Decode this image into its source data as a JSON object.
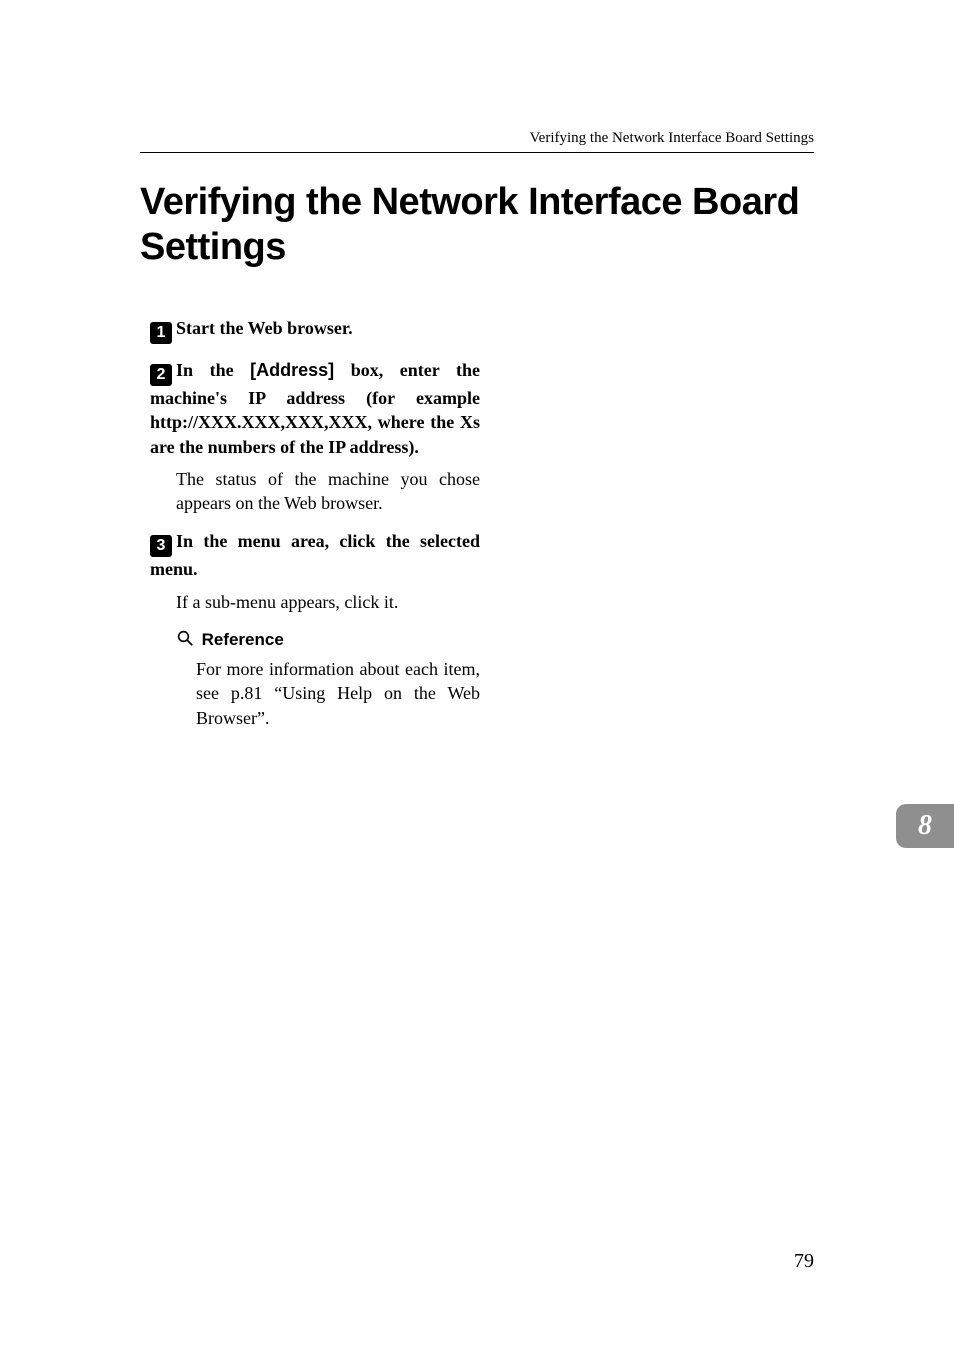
{
  "running_head": "Verifying the Network Interface Board Settings",
  "title": "Verifying the Network Interface Board Settings",
  "steps": [
    {
      "num": "1",
      "head_html": "Start the Web browser."
    },
    {
      "num": "2",
      "head_prefix": "In the ",
      "head_ui": "[Address]",
      "head_suffix": " box, enter the machine's IP address (for example http://XXX.XXX,XXX,XXX, where the Xs are the numbers of the IP address).",
      "body": "The status of the machine you chose appears on the Web browser."
    },
    {
      "num": "3",
      "head_html": "In the menu area, click the selected menu.",
      "body": "If a sub-menu appears, click it."
    }
  ],
  "reference": {
    "icon": "🔎",
    "label": "Reference",
    "body": "For more information about each item, see p.81 “Using Help on the Web Browser”."
  },
  "tab_number": "8",
  "page_number": "79"
}
